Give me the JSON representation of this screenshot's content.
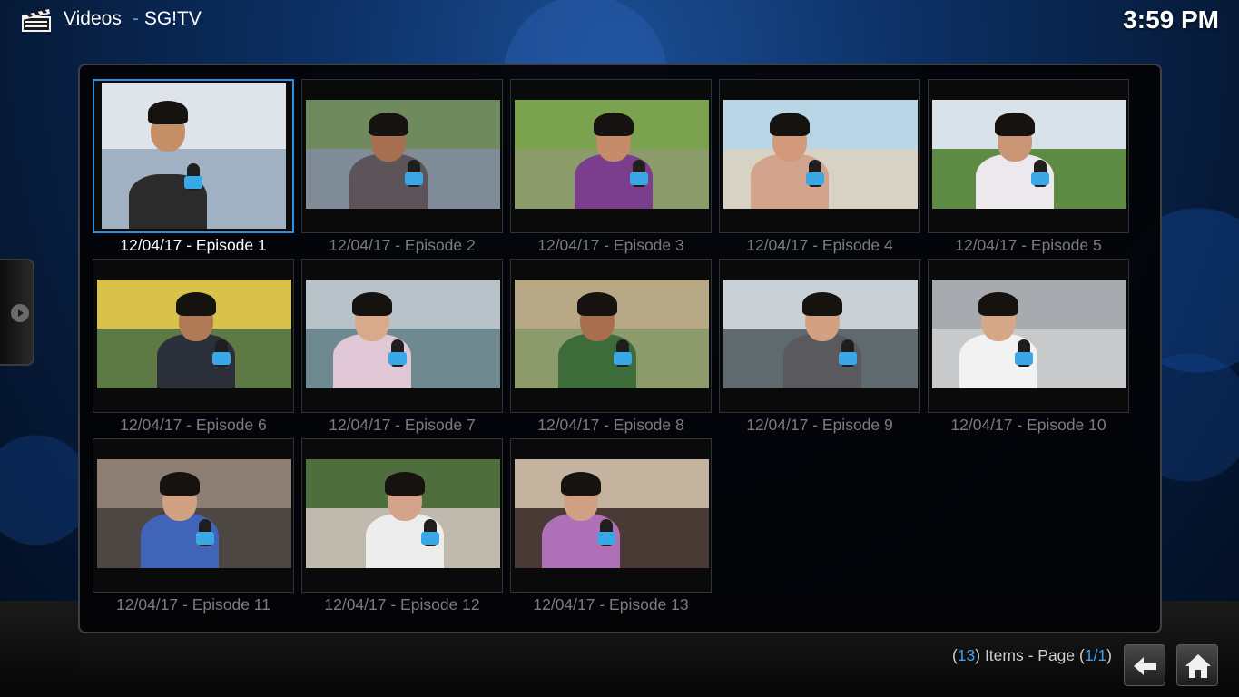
{
  "header": {
    "section": "Videos",
    "separator": "-",
    "source": "SG!TV",
    "clock": "3:59 PM"
  },
  "tiles": [
    {
      "label": "12/04/17 - Episode 1",
      "focused": true,
      "sky": "#dfe4ea",
      "ground": "#9fb1c2",
      "skin": "#c48f66",
      "shirt": "#2b2b2b"
    },
    {
      "label": "12/04/17 - Episode 2",
      "focused": false,
      "sky": "#6f8a5c",
      "ground": "#7f8b96",
      "skin": "#a87050",
      "shirt": "#5c5458"
    },
    {
      "label": "12/04/17 - Episode 3",
      "focused": false,
      "sky": "#7aa24f",
      "ground": "#8b9b6a",
      "skin": "#c68b69",
      "shirt": "#7a3e8c"
    },
    {
      "label": "12/04/17 - Episode 4",
      "focused": false,
      "sky": "#b9d6e6",
      "ground": "#d8d2c4",
      "skin": "#d29a7a",
      "shirt": "#d2a48e"
    },
    {
      "label": "12/04/17 - Episode 5",
      "focused": false,
      "sky": "#d7e2ea",
      "ground": "#5e8b43",
      "skin": "#c99574",
      "shirt": "#ece8ee"
    },
    {
      "label": "12/04/17 - Episode 6",
      "focused": false,
      "sky": "#d9c24a",
      "ground": "#5d7a44",
      "skin": "#b07a56",
      "shirt": "#2a2f3a"
    },
    {
      "label": "12/04/17 - Episode 7",
      "focused": false,
      "sky": "#b7c2c9",
      "ground": "#6e8a90",
      "skin": "#d8a98a",
      "shirt": "#e0c7d6"
    },
    {
      "label": "12/04/17 - Episode 8",
      "focused": false,
      "sky": "#b7a985",
      "ground": "#8c9a6c",
      "skin": "#a76f4e",
      "shirt": "#3d6b3a"
    },
    {
      "label": "12/04/17 - Episode 9",
      "focused": false,
      "sky": "#c9d1d7",
      "ground": "#5e6a6e",
      "skin": "#d2a182",
      "shirt": "#5a5a5e"
    },
    {
      "label": "12/04/17 - Episode 10",
      "focused": false,
      "sky": "#a7aaae",
      "ground": "#c7c9cb",
      "skin": "#d6a787",
      "shirt": "#f2f2f2"
    },
    {
      "label": "12/04/17 - Episode 11",
      "focused": false,
      "sky": "#8d7f74",
      "ground": "#4d4744",
      "skin": "#d2a083",
      "shirt": "#3f64b8"
    },
    {
      "label": "12/04/17 - Episode 12",
      "focused": false,
      "sky": "#4f6e3e",
      "ground": "#c0b9ae",
      "skin": "#d3a489",
      "shirt": "#ededed"
    },
    {
      "label": "12/04/17 - Episode 13",
      "focused": false,
      "sky": "#c3b39f",
      "ground": "#4a3a36",
      "skin": "#d0a084",
      "shirt": "#b070b8"
    }
  ],
  "footer": {
    "count_open": "(",
    "count": "13",
    "count_close": ") Items - Page (",
    "page": "1/1",
    "page_close": ")"
  },
  "icons": {
    "clapperboard": "clapperboard-icon",
    "side_arrow": "chevron-right-icon",
    "back": "back-arrow-icon",
    "home": "home-icon"
  },
  "colors": {
    "accent": "#2b8fe0",
    "label_dim": "#7c7c7c",
    "label_focus": "#ffffff"
  }
}
